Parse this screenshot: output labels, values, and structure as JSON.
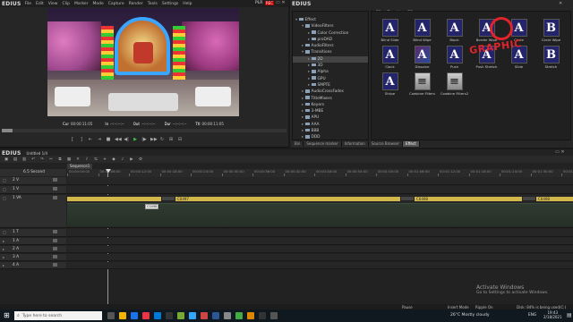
{
  "player": {
    "logo": "EDIUS",
    "menu": [
      "File",
      "Edit",
      "View",
      "Clip",
      "Marker",
      "Mode",
      "Capture",
      "Render",
      "Tools",
      "Settings",
      "Help"
    ],
    "mode": "PLR",
    "rec": "REC",
    "cur_label": "Cur",
    "cur_value": "00:00:11:05",
    "in_label": "In",
    "in_value": "--:--:--:--",
    "out_label": "Out",
    "out_value": "--:--:--:--",
    "dur_label": "Dur",
    "dur_value": "--:--:--:--",
    "ttl_label": "Ttl",
    "ttl_value": "00:00:11:05"
  },
  "right_panel": {
    "logo": "EDIUS",
    "folder_label": "FOLDER",
    "path": "Effect/Transitions/2D",
    "tree": [
      {
        "label": "Effect",
        "indent": 0,
        "icon": "▾"
      },
      {
        "label": "VideoFilters",
        "indent": 1,
        "icon": "▾"
      },
      {
        "label": "Color Correction",
        "indent": 2,
        "icon": ""
      },
      {
        "label": "proDAD",
        "indent": 2,
        "icon": ""
      },
      {
        "label": "AudioFilters",
        "indent": 1,
        "icon": ""
      },
      {
        "label": "Transitions",
        "indent": 1,
        "icon": "▾"
      },
      {
        "label": "2D",
        "indent": 2,
        "icon": "",
        "sel": true
      },
      {
        "label": "3D",
        "indent": 2,
        "icon": ""
      },
      {
        "label": "Alpha",
        "indent": 2,
        "icon": ""
      },
      {
        "label": "GPU",
        "indent": 2,
        "icon": ""
      },
      {
        "label": "SMPTE",
        "indent": 2,
        "icon": ""
      },
      {
        "label": "AudioCrossFades",
        "indent": 1,
        "icon": ""
      },
      {
        "label": "TitleMixers",
        "indent": 1,
        "icon": ""
      },
      {
        "label": "Keyers",
        "indent": 1,
        "icon": ""
      },
      {
        "label": "3-MBE",
        "indent": 1,
        "icon": ""
      },
      {
        "label": "APU",
        "indent": 1,
        "icon": ""
      },
      {
        "label": "AAA",
        "indent": 1,
        "icon": ""
      },
      {
        "label": "BBB",
        "indent": 1,
        "icon": ""
      },
      {
        "label": "DDD",
        "indent": 1,
        "icon": ""
      },
      {
        "label": "PPP",
        "indent": 1,
        "icon": ""
      }
    ],
    "effects": [
      {
        "label": "Blind Slide",
        "glyph": "A"
      },
      {
        "label": "Blind Wipe",
        "glyph": "A"
      },
      {
        "label": "Block",
        "glyph": "A"
      },
      {
        "label": "Border Wipe",
        "glyph": "A"
      },
      {
        "label": "Circle",
        "glyph": "A"
      },
      {
        "label": "Circle Wipe",
        "glyph": "B"
      },
      {
        "label": "Clock",
        "glyph": "A"
      },
      {
        "label": "Dissolve",
        "glyph": "A"
      },
      {
        "label": "Push",
        "glyph": "A"
      },
      {
        "label": "Push Stretch",
        "glyph": "A"
      },
      {
        "label": "Slide",
        "glyph": "A"
      },
      {
        "label": "Stretch",
        "glyph": "B"
      },
      {
        "label": "Stripe",
        "glyph": "A"
      },
      {
        "label": "Cowbine Filters",
        "glyph": ""
      },
      {
        "label": "Cowbine Filters2",
        "glyph": ""
      }
    ],
    "tabs": [
      "Bin",
      "Sequence marker",
      "Information",
      "Source Browser",
      "Effect"
    ],
    "active_tab": "Effect",
    "watermark": "GRAPHIC"
  },
  "timeline": {
    "logo": "EDIUS",
    "project": "Untitled 1/4",
    "sequence_tab": "Sequence1",
    "scale": "6.5 Second",
    "timecodes": [
      "00:00:00:00",
      "00:00:06:00",
      "00:00:12:00",
      "00:00:18:00",
      "00:00:24:00",
      "00:00:30:00",
      "00:00:36:00",
      "00:00:42:00",
      "00:00:48:00",
      "00:00:54:00",
      "00:01:00:00",
      "00:01:06:00",
      "00:01:12:00",
      "00:01:18:00",
      "00:01:24:00",
      "00:01:30:00",
      "00:01:36:00"
    ],
    "tracks": [
      {
        "name": "2 V",
        "type": "v"
      },
      {
        "name": "1 V",
        "type": "v"
      },
      {
        "name": "1 VA",
        "type": "va"
      },
      {
        "name": "1 T",
        "type": "t"
      },
      {
        "name": "1 A",
        "type": "a"
      },
      {
        "name": "2 A",
        "type": "a"
      },
      {
        "name": "3 A",
        "type": "a"
      },
      {
        "name": "4 A",
        "type": "a"
      }
    ],
    "clips": [
      "C0497",
      "C0498",
      "C0498"
    ],
    "tooltip": "C0498",
    "status": {
      "pause": "Pause",
      "insert": "Insert Mode",
      "ripple": "Ripple On",
      "disk": "Disk: 84% is being used(C:)"
    }
  },
  "activation": {
    "title": "Activate Windows",
    "sub": "Go to Settings to activate Windows."
  },
  "taskbar": {
    "search_placeholder": "Type here to search",
    "weather": "26°C Mostly cloudy",
    "lang": "ENG",
    "time": "19:43",
    "date": "2/18/2021"
  }
}
